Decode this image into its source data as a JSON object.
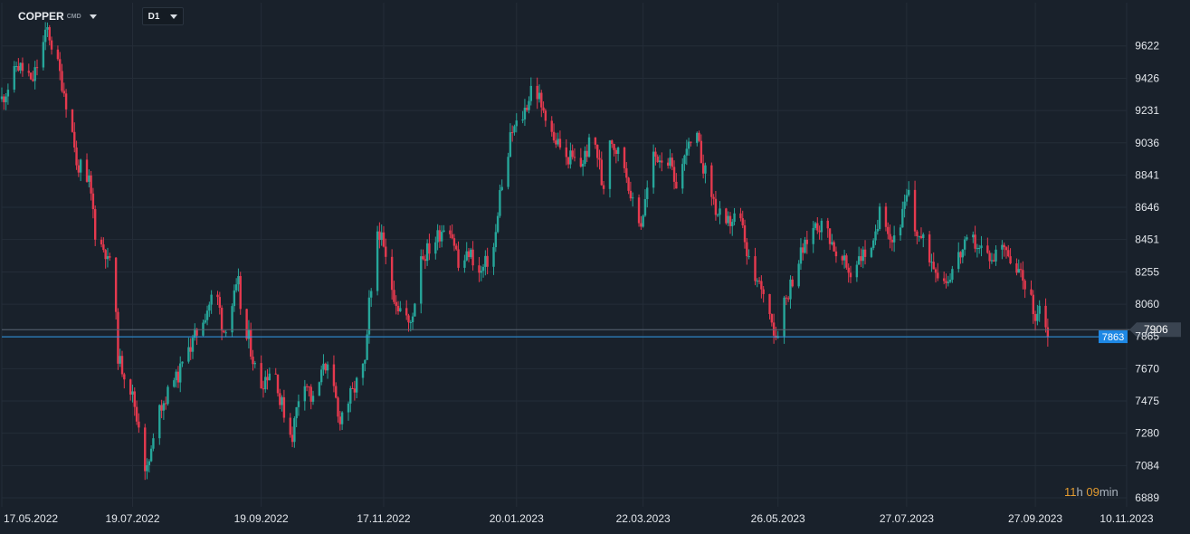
{
  "header": {
    "symbol": "COPPER",
    "symbol_type": "CMD",
    "timeframe": "D1"
  },
  "countdown": {
    "hours": "11",
    "h_unit": "h",
    "minutes": "09",
    "m_unit": "min"
  },
  "colors": {
    "background": "#19212b",
    "grid": "#242d38",
    "up": "#26a69a",
    "down": "#e5394e",
    "current_price_line": "#2f9be8",
    "current_price_label": "#1e88e5",
    "level_label": "#3a4451",
    "axis_text": "#e3e7ec"
  },
  "chart_data": {
    "type": "candlestick",
    "instrument": "COPPER",
    "timeframe": "D1",
    "x_tick_labels": [
      "17.05.2022",
      "19.07.2022",
      "19.09.2022",
      "17.11.2022",
      "20.01.2023",
      "22.03.2023",
      "26.05.2023",
      "27.07.2023",
      "27.09.2023",
      "10.11.2023"
    ],
    "y_tick_labels": [
      "9622",
      "9426",
      "9231",
      "9036",
      "8841",
      "8646",
      "8451",
      "8255",
      "8060",
      "7865",
      "7670",
      "7475",
      "7280",
      "7084",
      "6889"
    ],
    "y_range": [
      6889,
      9719
    ],
    "x_range": [
      "2022-05-17",
      "2023-11-10"
    ],
    "current_price": 7863,
    "current_price_label": "7863",
    "horizontal_level": 7906,
    "horizontal_level_label": "7906",
    "close_path": [
      {
        "date": "2022-05-17",
        "close": 9300
      },
      {
        "date": "2022-05-25",
        "close": 9500
      },
      {
        "date": "2022-06-01",
        "close": 9420
      },
      {
        "date": "2022-06-08",
        "close": 9720
      },
      {
        "date": "2022-06-11",
        "close": 9600
      },
      {
        "date": "2022-06-16",
        "close": 9350
      },
      {
        "date": "2022-06-23",
        "close": 8900
      },
      {
        "date": "2022-06-28",
        "close": 8800
      },
      {
        "date": "2022-07-02",
        "close": 8450
      },
      {
        "date": "2022-07-08",
        "close": 8350
      },
      {
        "date": "2022-07-13",
        "close": 7700
      },
      {
        "date": "2022-07-17",
        "close": 7600
      },
      {
        "date": "2022-07-22",
        "close": 7350
      },
      {
        "date": "2022-07-26",
        "close": 7050
      },
      {
        "date": "2022-08-02",
        "close": 7450
      },
      {
        "date": "2022-08-09",
        "close": 7600
      },
      {
        "date": "2022-08-16",
        "close": 7800
      },
      {
        "date": "2022-08-21",
        "close": 7950
      },
      {
        "date": "2022-08-28",
        "close": 8150
      },
      {
        "date": "2022-09-01",
        "close": 7900
      },
      {
        "date": "2022-09-08",
        "close": 8180
      },
      {
        "date": "2022-09-11",
        "close": 7780
      },
      {
        "date": "2022-09-13",
        "close": 7850
      },
      {
        "date": "2022-09-18",
        "close": 7560
      },
      {
        "date": "2022-09-25",
        "close": 7700
      },
      {
        "date": "2022-09-29",
        "close": 7450
      },
      {
        "date": "2022-10-04",
        "close": 7270
      },
      {
        "date": "2022-10-09",
        "close": 7650
      },
      {
        "date": "2022-10-14",
        "close": 7470
      },
      {
        "date": "2022-10-20",
        "close": 7700
      },
      {
        "date": "2022-10-27",
        "close": 7380
      },
      {
        "date": "2022-11-03",
        "close": 7550
      },
      {
        "date": "2022-11-08",
        "close": 7700
      },
      {
        "date": "2022-11-11",
        "close": 8100
      },
      {
        "date": "2022-11-15",
        "close": 8500
      },
      {
        "date": "2022-11-20",
        "close": 8200
      },
      {
        "date": "2022-11-24",
        "close": 8050
      },
      {
        "date": "2022-11-30",
        "close": 7950
      },
      {
        "date": "2022-12-06",
        "close": 8350
      },
      {
        "date": "2022-12-12",
        "close": 8450
      },
      {
        "date": "2022-12-18",
        "close": 8580
      },
      {
        "date": "2022-12-24",
        "close": 8280
      },
      {
        "date": "2022-12-28",
        "close": 8380
      },
      {
        "date": "2023-01-03",
        "close": 8250
      },
      {
        "date": "2023-01-09",
        "close": 8400
      },
      {
        "date": "2023-01-13",
        "close": 8750
      },
      {
        "date": "2023-01-18",
        "close": 9100
      },
      {
        "date": "2023-01-23",
        "close": 9200
      },
      {
        "date": "2023-01-28",
        "close": 9380
      },
      {
        "date": "2023-02-02",
        "close": 9250
      },
      {
        "date": "2023-02-08",
        "close": 9050
      },
      {
        "date": "2023-02-14",
        "close": 8950
      },
      {
        "date": "2023-02-20",
        "close": 8900
      },
      {
        "date": "2023-02-26",
        "close": 9080
      },
      {
        "date": "2023-03-03",
        "close": 8780
      },
      {
        "date": "2023-03-07",
        "close": 9050
      },
      {
        "date": "2023-03-13",
        "close": 8900
      },
      {
        "date": "2023-03-17",
        "close": 8700
      },
      {
        "date": "2023-03-21",
        "close": 8550
      },
      {
        "date": "2023-03-27",
        "close": 8950
      },
      {
        "date": "2023-04-02",
        "close": 8960
      },
      {
        "date": "2023-04-07",
        "close": 8800
      },
      {
        "date": "2023-04-13",
        "close": 9000
      },
      {
        "date": "2023-04-17",
        "close": 9050
      },
      {
        "date": "2023-04-21",
        "close": 8850
      },
      {
        "date": "2023-04-27",
        "close": 8600
      },
      {
        "date": "2023-05-02",
        "close": 8550
      },
      {
        "date": "2023-05-07",
        "close": 8600
      },
      {
        "date": "2023-05-12",
        "close": 8350
      },
      {
        "date": "2023-05-16",
        "close": 8200
      },
      {
        "date": "2023-05-19",
        "close": 8150
      },
      {
        "date": "2023-05-23",
        "close": 8000
      },
      {
        "date": "2023-05-25",
        "close": 7870
      },
      {
        "date": "2023-05-30",
        "close": 8100
      },
      {
        "date": "2023-06-04",
        "close": 8300
      },
      {
        "date": "2023-06-09",
        "close": 8450
      },
      {
        "date": "2023-06-14",
        "close": 8550
      },
      {
        "date": "2023-06-19",
        "close": 8500
      },
      {
        "date": "2023-06-24",
        "close": 8350
      },
      {
        "date": "2023-06-30",
        "close": 8250
      },
      {
        "date": "2023-07-05",
        "close": 8350
      },
      {
        "date": "2023-07-11",
        "close": 8400
      },
      {
        "date": "2023-07-15",
        "close": 8650
      },
      {
        "date": "2023-07-20",
        "close": 8450
      },
      {
        "date": "2023-07-24",
        "close": 8560
      },
      {
        "date": "2023-07-28",
        "close": 8720
      },
      {
        "date": "2023-08-01",
        "close": 8500
      },
      {
        "date": "2023-08-06",
        "close": 8380
      },
      {
        "date": "2023-08-11",
        "close": 8250
      },
      {
        "date": "2023-08-15",
        "close": 8200
      },
      {
        "date": "2023-08-21",
        "close": 8350
      },
      {
        "date": "2023-08-27",
        "close": 8450
      },
      {
        "date": "2023-09-01",
        "close": 8400
      },
      {
        "date": "2023-09-06",
        "close": 8320
      },
      {
        "date": "2023-09-11",
        "close": 8450
      },
      {
        "date": "2023-09-15",
        "close": 8350
      },
      {
        "date": "2023-09-19",
        "close": 8250
      },
      {
        "date": "2023-09-23",
        "close": 8150
      },
      {
        "date": "2023-09-27",
        "close": 8000
      },
      {
        "date": "2023-09-30",
        "close": 8050
      },
      {
        "date": "2023-10-04",
        "close": 7863
      }
    ]
  }
}
